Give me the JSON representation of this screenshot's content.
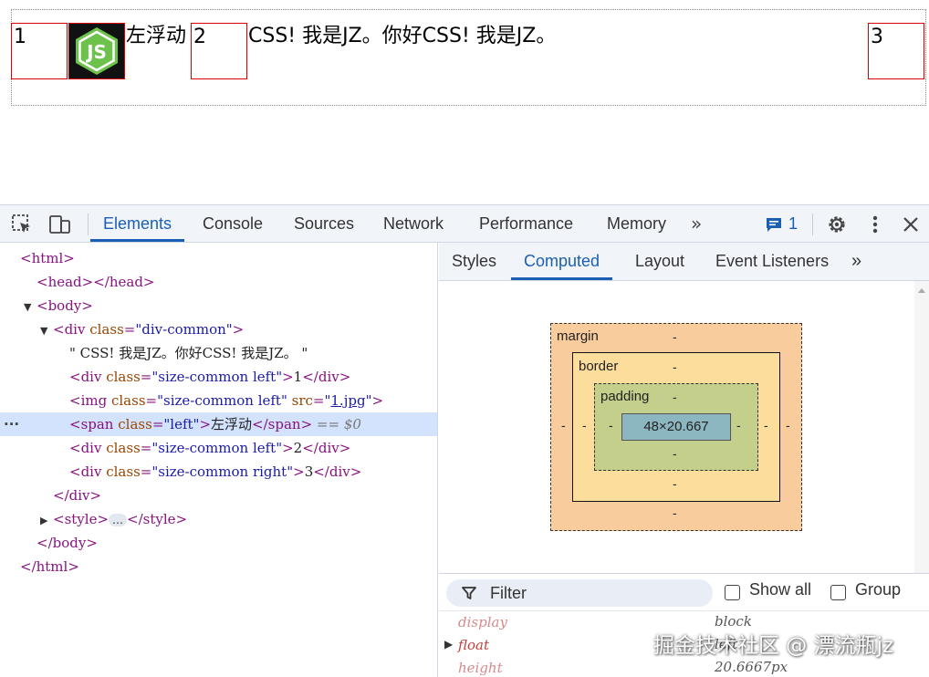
{
  "page": {
    "box1": "1",
    "float_text": "左浮动",
    "box2": "2",
    "inline_text": "CSS! 我是JZ。你好CSS! 我是JZ。",
    "box3": "3",
    "image_icon": "nodejs-js-logo-icon",
    "image_logo_text": "JS"
  },
  "devtools": {
    "toolbar_icons": [
      "inspect-element-icon",
      "device-toolbar-icon"
    ],
    "tabs": [
      "Elements",
      "Console",
      "Sources",
      "Network",
      "Performance",
      "Memory"
    ],
    "active_tab": "Elements",
    "more_tabs": "»",
    "issues_count": "1",
    "accent": "#1a5fb4"
  },
  "dom": {
    "html_open": "<html>",
    "head": "<head></head>",
    "body_open": "<body>",
    "div_open_tag": "<div",
    "attr_class": "class",
    "div_common": "\"div-common\"",
    "close_bracket": ">",
    "text_node": "\" CSS! 我是JZ。你好CSS! 我是JZ。 \"",
    "size_common_left": "\"size-common left\"",
    "size_common_right": "\"size-common right\"",
    "div_close": "</div>",
    "div1_text": "1",
    "div2_text": "2",
    "div3_text": "3",
    "img_open": "<img",
    "attr_src": "src",
    "src_value": "1.jpg",
    "span_open": "<span",
    "left_value": "\"left\"",
    "span_text": "左浮动",
    "span_close": "</span>",
    "eq_s0": "== $0",
    "style_open": "<style>",
    "style_close": "</style>",
    "ellipsis": "…",
    "body_close": "</body>",
    "html_close": "</html>",
    "selected_row_bg": "#d3e3fd"
  },
  "side": {
    "tabs": [
      "Styles",
      "Computed",
      "Layout",
      "Event Listeners"
    ],
    "active_tab": "Computed",
    "more_tabs": "»",
    "box_model": {
      "margin_label": "margin",
      "border_label": "border",
      "padding_label": "padding",
      "content": "48×20.667",
      "dash": "-",
      "colors": {
        "margin": "#f9cc9d",
        "border": "#fddd9b",
        "padding": "#c3cf8a",
        "content": "#8cb6c0"
      }
    },
    "filter": {
      "placeholder": "Filter",
      "show_all": "Show all",
      "group": "Group"
    },
    "properties": [
      {
        "name": "display",
        "value": "block"
      },
      {
        "name": "float",
        "value": "left"
      },
      {
        "name": "height",
        "value": "20.6667px"
      }
    ]
  },
  "watermark": "掘金技术社区 @ 漂流瓶jz"
}
